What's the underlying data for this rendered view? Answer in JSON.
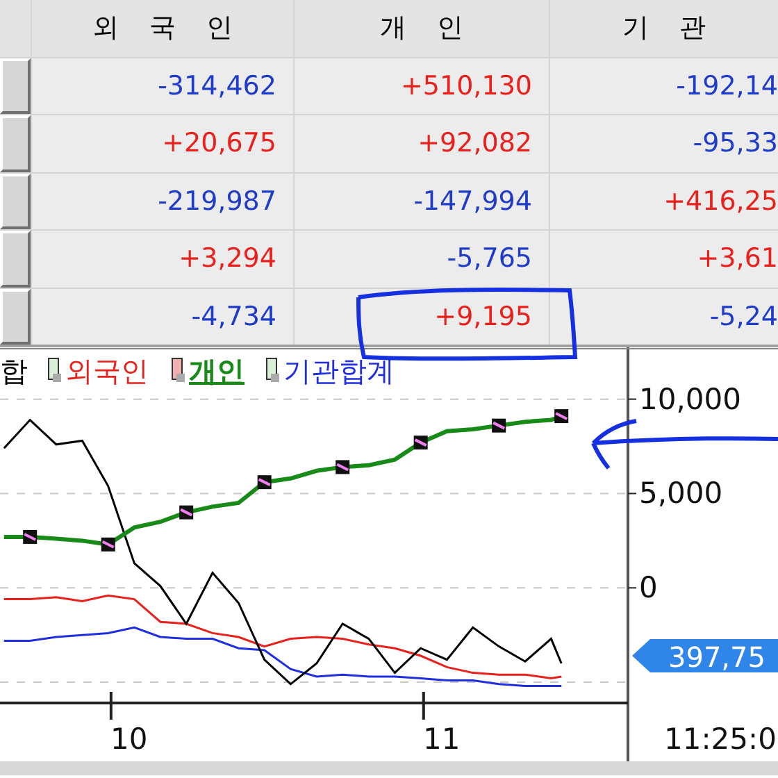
{
  "table": {
    "columns": [
      "외 국 인",
      "개 인",
      "기 관"
    ],
    "rows": [
      [
        {
          "text": "-314,462",
          "color": "#1f3cc8"
        },
        {
          "text": "+510,130",
          "color": "#e8211c"
        },
        {
          "text": "-192,14",
          "color": "#1f3cc8"
        }
      ],
      [
        {
          "text": "+20,675",
          "color": "#e8211c"
        },
        {
          "text": "+92,082",
          "color": "#e8211c"
        },
        {
          "text": "-95,33",
          "color": "#1f3cc8"
        }
      ],
      [
        {
          "text": "-219,987",
          "color": "#1f3cc8"
        },
        {
          "text": "-147,994",
          "color": "#1f3cc8"
        },
        {
          "text": "+416,25",
          "color": "#e8211c"
        }
      ],
      [
        {
          "text": "+3,294",
          "color": "#e8211c"
        },
        {
          "text": "-5,765",
          "color": "#1f3cc8"
        },
        {
          "text": "+3,61",
          "color": "#e8211c"
        }
      ],
      [
        {
          "text": "-4,734",
          "color": "#1f3cc8"
        },
        {
          "text": "+9,195",
          "color": "#e8211c"
        },
        {
          "text": "-5,24",
          "color": "#1f3cc8"
        }
      ]
    ]
  },
  "chart": {
    "current_value": "397,75",
    "time_label": "11:25:0",
    "legend": [
      {
        "selected": false
      },
      {
        "selected": false
      },
      {
        "selected": true
      },
      {
        "selected": false
      }
    ],
    "chart_data": {
      "type": "line",
      "grid": true,
      "x": [
        9.6,
        9.683,
        9.767,
        9.85,
        9.933,
        10.017,
        10.1,
        10.183,
        10.267,
        10.35,
        10.433,
        10.517,
        10.6,
        10.683,
        10.767,
        10.85,
        10.933,
        11.017,
        11.1,
        11.183,
        11.267,
        11.35,
        11.383
      ],
      "xlim": [
        9.587,
        11.596
      ],
      "ylim": [
        -6100,
        12600
      ],
      "xticks": [
        10,
        11
      ],
      "yticks": [
        {
          "value": 10000,
          "label": "10,000"
        },
        {
          "value": 5000,
          "label": "5,000"
        },
        {
          "value": 0,
          "label": "0"
        }
      ],
      "series": [
        {
          "name": "합",
          "color": "#000000",
          "values": [
            7400,
            8900,
            7600,
            7800,
            5400,
            1300,
            100,
            -1900,
            800,
            -800,
            -3800,
            -5100,
            -4000,
            -1900,
            -2700,
            -4500,
            -3200,
            -3800,
            -2100,
            -3100,
            -3900,
            -2700,
            -4000
          ]
        },
        {
          "name": "외국인",
          "color": "#e8211c",
          "values": [
            -600,
            -600,
            -500,
            -700,
            -400,
            -600,
            -1800,
            -1900,
            -2400,
            -2600,
            -3100,
            -2700,
            -2600,
            -2700,
            -3000,
            -3200,
            -3600,
            -4200,
            -4500,
            -4600,
            -4600,
            -4800,
            -4700
          ]
        },
        {
          "name": "개인",
          "color": "#178a17",
          "values": [
            2700,
            2700,
            2600,
            2500,
            2300,
            3200,
            3500,
            4000,
            4300,
            4500,
            5600,
            5800,
            6200,
            6400,
            6500,
            6800,
            7700,
            8300,
            8400,
            8600,
            8800,
            8900,
            9100
          ]
        },
        {
          "name": "기관합계",
          "color": "#1f2fe0",
          "values": [
            -2800,
            -2800,
            -2600,
            -2500,
            -2400,
            -2100,
            -2600,
            -2700,
            -2700,
            -3200,
            -3300,
            -4300,
            -4700,
            -4600,
            -4700,
            -4700,
            -4800,
            -4900,
            -4900,
            -5100,
            -5200,
            -5200,
            -5200
          ]
        }
      ]
    }
  }
}
